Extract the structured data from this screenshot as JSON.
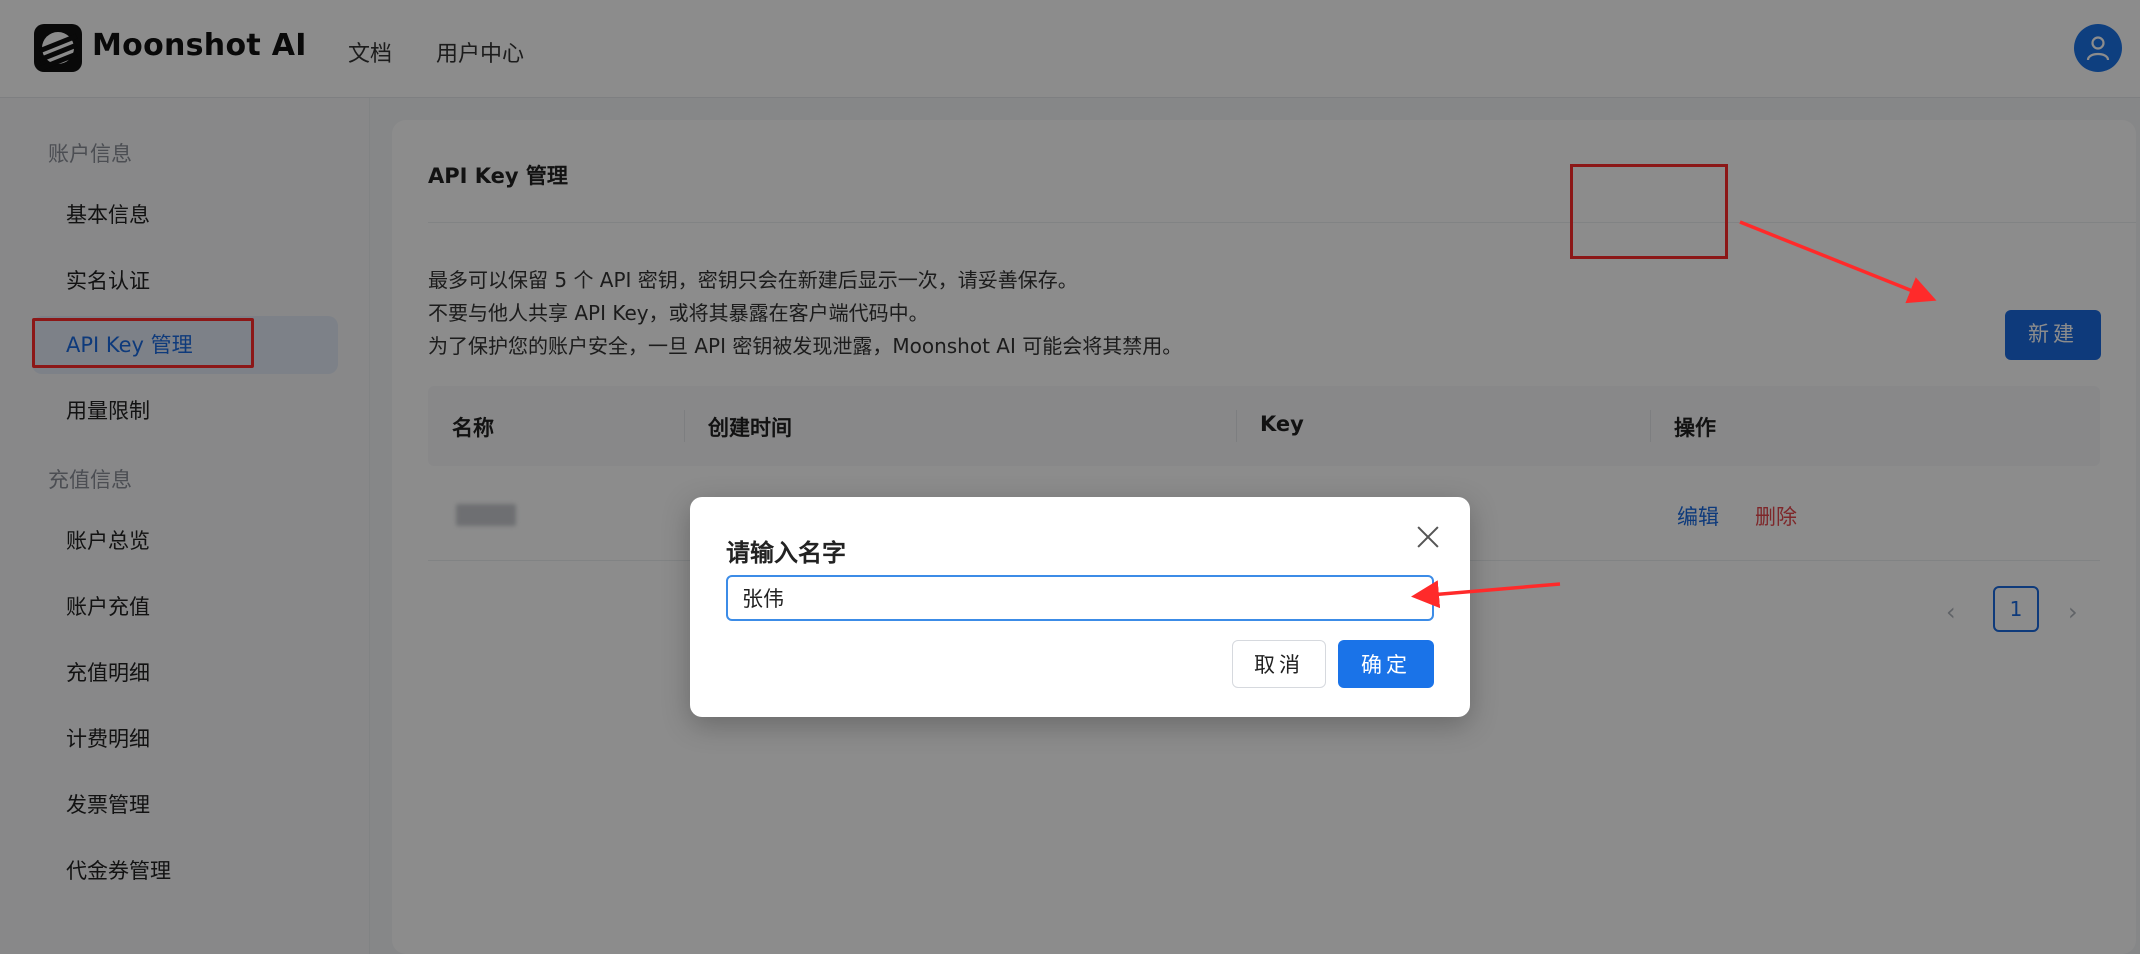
{
  "header": {
    "brand": "Moonshot AI",
    "nav": [
      {
        "label": "文档"
      },
      {
        "label": "用户中心"
      }
    ]
  },
  "sidebar": {
    "groups": [
      {
        "title": "账户信息",
        "items": [
          "基本信息",
          "实名认证",
          "API Key 管理",
          "用量限制"
        ]
      },
      {
        "title": "充值信息",
        "items": [
          "账户总览",
          "账户充值",
          "充值明细",
          "计费明细",
          "发票管理",
          "代金券管理"
        ]
      }
    ],
    "active": "API Key 管理"
  },
  "main": {
    "title": "API Key 管理",
    "notices": [
      "最多可以保留 5 个 API 密钥，密钥只会在新建后显示一次，请妥善保存。",
      "不要与他人共享 API Key，或将其暴露在客户端代码中。",
      "为了保护您的账户安全，一旦 API 密钥被发现泄露，Moonshot AI 可能会将其禁用。"
    ],
    "new_button": "新建",
    "table": {
      "columns": [
        "名称",
        "创建时间",
        "Key",
        "操作"
      ],
      "row_actions": {
        "edit": "编辑",
        "delete": "删除"
      }
    },
    "pagination": {
      "current": "1"
    }
  },
  "modal": {
    "title": "请输入名字",
    "input_value": "张伟",
    "cancel": "取消",
    "confirm": "确定"
  },
  "colors": {
    "accent": "#1a6ae0",
    "highlight": "#ff2a2a",
    "danger": "#e5484d"
  },
  "icons": {
    "logo": "moonshot-logo-icon",
    "avatar": "user-icon",
    "close": "close-icon",
    "prev": "chevron-left-icon",
    "next": "chevron-right-icon"
  }
}
